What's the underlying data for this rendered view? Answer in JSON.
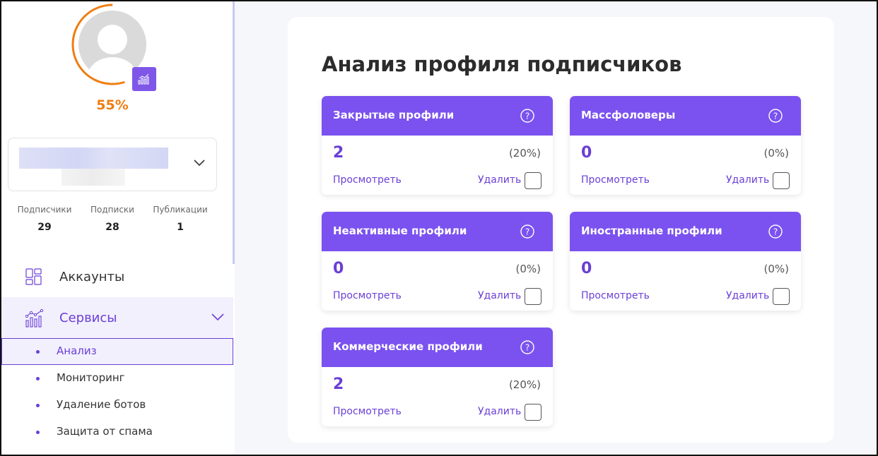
{
  "profile": {
    "progress_percent": 55,
    "progress_label": "55%",
    "stats": [
      {
        "label": "Подписчики",
        "value": "29"
      },
      {
        "label": "Подписки",
        "value": "28"
      },
      {
        "label": "Публикации",
        "value": "1"
      }
    ]
  },
  "sidebar": {
    "nav": [
      {
        "label": "Аккаунты",
        "icon": "dashboard-grid-icon"
      },
      {
        "label": "Сервисы",
        "icon": "analytics-chart-icon"
      }
    ],
    "sub_items": [
      {
        "label": "Анализ"
      },
      {
        "label": "Мониторинг"
      },
      {
        "label": "Удаление ботов"
      },
      {
        "label": "Защита от спама"
      }
    ]
  },
  "main": {
    "title": "Анализ профиля подписчиков",
    "cards": [
      {
        "title": "Закрытые профили",
        "count": "2",
        "percent": "(20%)",
        "view": "Просмотреть",
        "delete": "Удалить"
      },
      {
        "title": "Массфоловеры",
        "count": "0",
        "percent": "(0%)",
        "view": "Просмотреть",
        "delete": "Удалить"
      },
      {
        "title": "Неактивные профили",
        "count": "0",
        "percent": "(0%)",
        "view": "Просмотреть",
        "delete": "Удалить"
      },
      {
        "title": "Иностранные профили",
        "count": "0",
        "percent": "(0%)",
        "view": "Просмотреть",
        "delete": "Удалить"
      },
      {
        "title": "Коммерческие профили",
        "count": "2",
        "percent": "(20%)",
        "view": "Просмотреть",
        "delete": "Удалить"
      }
    ]
  },
  "colors": {
    "accent": "#7b52ef",
    "accent_text": "#6a3fd6",
    "progress": "#ef7d12",
    "active_bg": "#f2f0fd"
  }
}
